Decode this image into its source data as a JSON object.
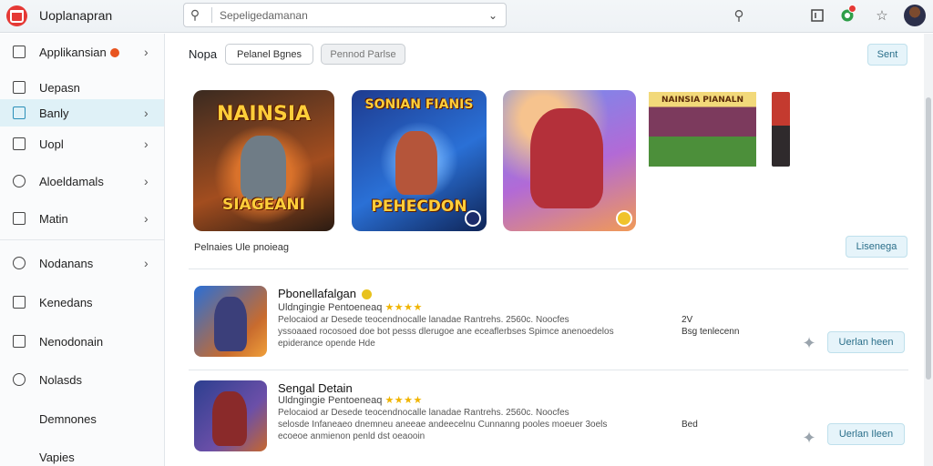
{
  "app": {
    "title": "Uoplanapran"
  },
  "search": {
    "value": "Sepeligedamanan"
  },
  "sidebar": {
    "items": [
      {
        "label": "Applikansian",
        "has_arrow": true
      },
      {
        "label": "Uepasn",
        "has_arrow": false
      },
      {
        "label": "Banly",
        "has_arrow": true
      },
      {
        "label": "Uopl",
        "has_arrow": true
      },
      {
        "label": "Aloeldamals",
        "has_arrow": true
      },
      {
        "label": "Matin",
        "has_arrow": true
      },
      {
        "label": "Nodanans",
        "has_arrow": true
      },
      {
        "label": "Kenedans",
        "has_arrow": false
      },
      {
        "label": "Nenodonain",
        "has_arrow": false
      },
      {
        "label": "Nolasds",
        "has_arrow": false
      },
      {
        "label": "Demnones",
        "has_arrow": false
      },
      {
        "label": "Vapies",
        "has_arrow": false
      }
    ]
  },
  "filters": {
    "label": "Nopa",
    "chips": [
      "Pelanel Bgnes",
      "Pennod Parlse"
    ],
    "sort_button": "Sent"
  },
  "featured": {
    "tiles": [
      {
        "title": "NAINSIA",
        "subtitle": "SIAGEANI"
      },
      {
        "title": "SONIAN FIANIS",
        "subtitle": "PEHECDON"
      },
      {
        "title": "",
        "subtitle": ""
      },
      {
        "title": "NAINSIA PIANALN",
        "subtitle": ""
      },
      {
        "title": "",
        "subtitle": ""
      }
    ],
    "caption": "Pelnaies Ule pnoieag",
    "action": "Lisenega"
  },
  "apps": [
    {
      "title": "Pbonellafalgan",
      "subtitle": "Uldngingie Pentoeneaq",
      "desc": [
        "Pelocaiod ar Desede teocendnocalle lanadae Rantrehs. 2560c. Noocfes",
        "yssoaaed rocosoed doe bot pesss dlerugoe ane eceaflerbses Spimce anenoedelos",
        "epiderance opende Hde"
      ],
      "extra": "2V",
      "meta": "Bsg tenlecenn",
      "button": "Uerlan heen"
    },
    {
      "title": "Sengal Detain",
      "subtitle": "Uldngingie Pentoeneaq",
      "desc": [
        "Pelocaiod ar Desede teocendnocalle lanadae Rantrehs. 2560c. Noocfes",
        "selosde Infaneaeo dnemneu aneeae andeecelnu Cunnanng pooles moeuer 3oels",
        "ecoeoe anmienon penld dst oeaooin"
      ],
      "extra": "",
      "meta": "Bed",
      "button": "Uerlan Ileen"
    }
  ],
  "colors": {
    "accent": "#2b6f8a",
    "accent_bg": "#e6f4fa",
    "active_nav_bg": "#dff1f7",
    "star": "#f0b400",
    "logo": "#e53935"
  },
  "icons": {
    "topbar": [
      "search-icon",
      "calendar-icon",
      "notification-icon",
      "star-icon",
      "avatar"
    ]
  }
}
